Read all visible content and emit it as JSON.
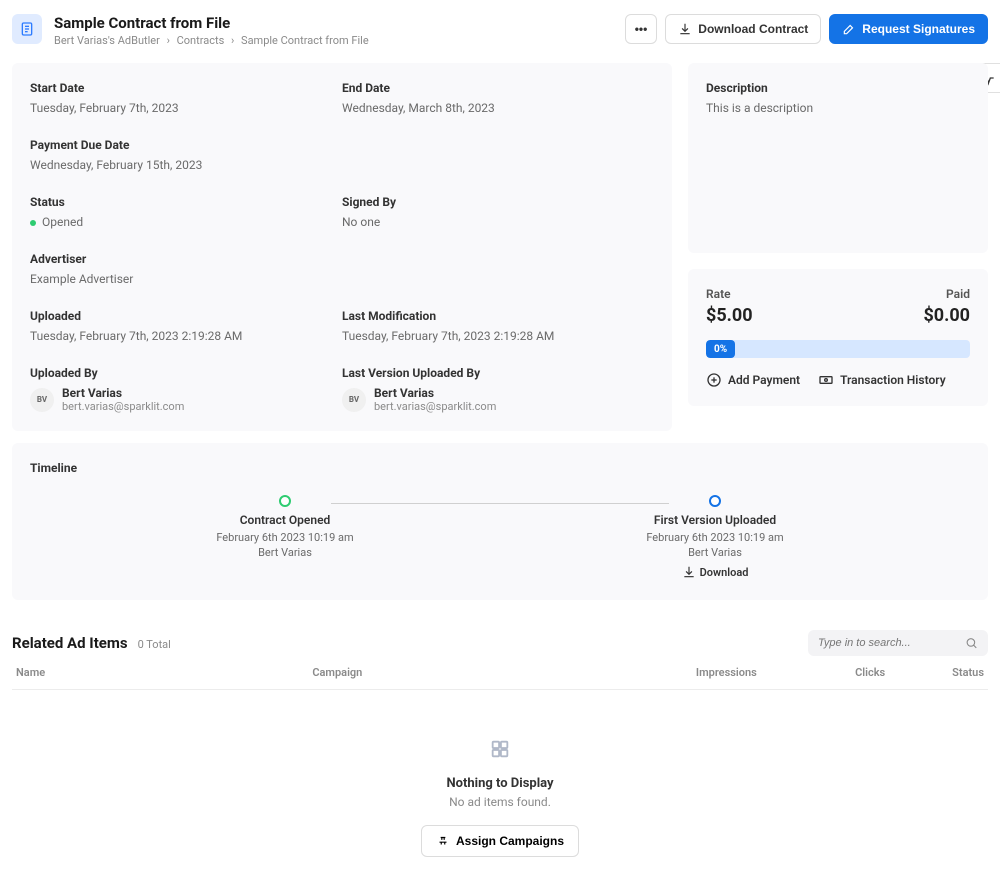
{
  "header": {
    "title": "Sample Contract from File",
    "breadcrumbs": [
      "Bert Varias's AdButler",
      "Contracts",
      "Sample Contract from File"
    ],
    "download_contract_label": "Download Contract",
    "request_signatures_label": "Request Signatures"
  },
  "details": {
    "start_date_label": "Start Date",
    "start_date_value": "Tuesday, February 7th, 2023",
    "end_date_label": "End Date",
    "end_date_value": "Wednesday, March 8th, 2023",
    "payment_due_label": "Payment Due Date",
    "payment_due_value": "Wednesday, February 15th, 2023",
    "status_label": "Status",
    "status_value": "Opened",
    "signed_by_label": "Signed By",
    "signed_by_value": "No one",
    "advertiser_label": "Advertiser",
    "advertiser_value": "Example Advertiser",
    "uploaded_label": "Uploaded",
    "uploaded_value": "Tuesday, February 7th, 2023 2:19:28 AM",
    "last_mod_label": "Last Modification",
    "last_mod_value": "Tuesday, February 7th, 2023 2:19:28 AM",
    "uploaded_by_label": "Uploaded By",
    "last_version_by_label": "Last Version Uploaded By",
    "uploader": {
      "initials": "BV",
      "name": "Bert Varias",
      "email": "bert.varias@sparklit.com"
    },
    "last_uploader": {
      "initials": "BV",
      "name": "Bert Varias",
      "email": "bert.varias@sparklit.com"
    }
  },
  "description": {
    "label": "Description",
    "value": "This is a description"
  },
  "payment": {
    "rate_label": "Rate",
    "rate_value": "$5.00",
    "paid_label": "Paid",
    "paid_value": "$0.00",
    "progress_label": "0%",
    "add_payment_label": "Add Payment",
    "transaction_history_label": "Transaction History"
  },
  "timeline": {
    "label": "Timeline",
    "events": [
      {
        "title": "Contract Opened",
        "time": "February 6th 2023 10:19 am",
        "user": "Bert Varias",
        "dot": "green",
        "download": false
      },
      {
        "title": "First Version Uploaded",
        "time": "February 6th 2023 10:19 am",
        "user": "Bert Varias",
        "dot": "blue",
        "download": true,
        "download_label": "Download"
      }
    ]
  },
  "related": {
    "title": "Related Ad Items",
    "count": "0 Total",
    "search_placeholder": "Type in to search...",
    "columns": {
      "name": "Name",
      "campaign": "Campaign",
      "impressions": "Impressions",
      "clicks": "Clicks",
      "status": "Status"
    },
    "empty_title": "Nothing to Display",
    "empty_sub": "No ad items found.",
    "assign_label": "Assign Campaigns"
  }
}
